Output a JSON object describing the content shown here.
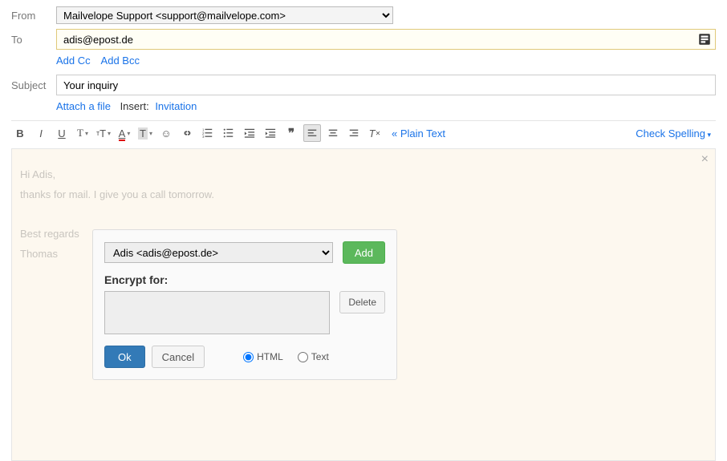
{
  "fields": {
    "from_label": "From",
    "from_value": "Mailvelope Support <support@mailvelope.com>",
    "to_label": "To",
    "to_value": "adis@epost.de",
    "add_cc": "Add Cc",
    "add_bcc": "Add Bcc",
    "subject_label": "Subject",
    "subject_value": "Your inquiry",
    "attach": "Attach a file",
    "insert_label": "Insert:",
    "invitation": "Invitation"
  },
  "toolbar": {
    "plain_text": "« Plain Text",
    "check_spelling": "Check Spelling"
  },
  "body": {
    "line1": "Hi Adis,",
    "line2": "thanks for mail. I give you a call tomorrow.",
    "line3": "Best regards",
    "line4": "Thomas"
  },
  "dialog": {
    "recipient": "Adis <adis@epost.de>",
    "add": "Add",
    "encrypt_for": "Encrypt for:",
    "delete": "Delete",
    "ok": "Ok",
    "cancel": "Cancel",
    "html": "HTML",
    "text": "Text"
  }
}
